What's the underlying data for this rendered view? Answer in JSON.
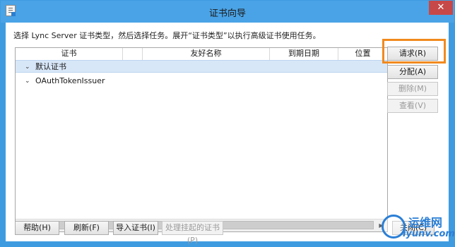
{
  "window": {
    "title": "证书向导",
    "close_glyph": "✕"
  },
  "instruction": "选择 Lync Server 证书类型，然后选择任务。展开“证书类型”以执行高级证书使用任务。",
  "grid": {
    "columns": [
      "证书",
      "",
      "友好名称",
      "到期日期",
      "位置"
    ],
    "rows": [
      {
        "label": "默认证书",
        "selected": true
      },
      {
        "label": "OAuthTokenIssuer",
        "selected": false
      }
    ]
  },
  "side_buttons": {
    "request": "请求(R)",
    "assign": "分配(A)",
    "remove": "删除(M)",
    "view": "查看(V)"
  },
  "bottom_buttons": {
    "help": "帮助(H)",
    "refresh": "刷新(F)",
    "import": "导入证书(I)",
    "pending": "处理挂起的证书(P)",
    "close": "关闭(C)"
  },
  "watermark": {
    "text": "运维网",
    "url": "iyunv.com"
  },
  "colors": {
    "titlebar": "#4aa3e6",
    "highlight": "#f18a1e",
    "selected_row": "#d8e7f8",
    "watermark": "#2b7fd6"
  }
}
